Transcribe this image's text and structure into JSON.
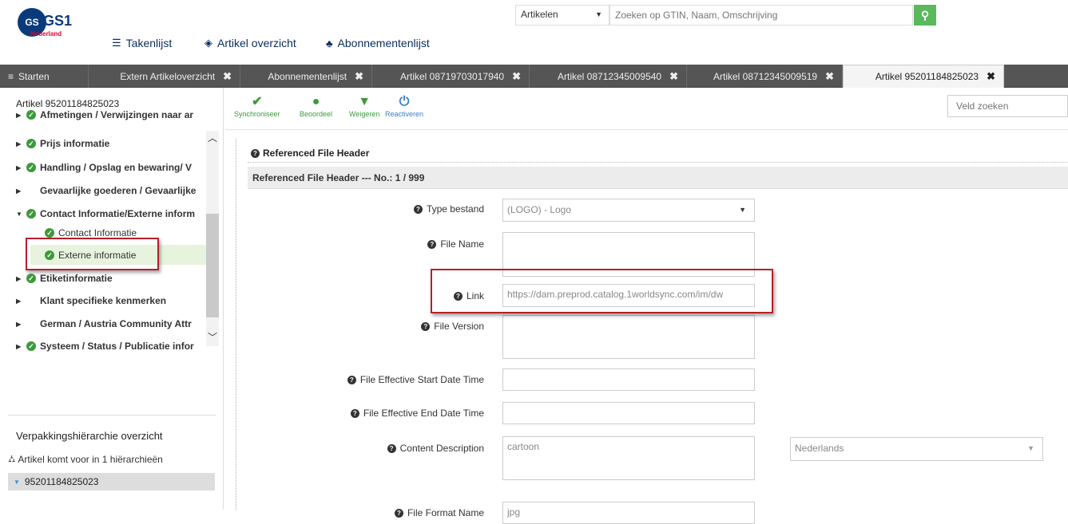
{
  "header": {
    "logo_main": "GS1",
    "logo_sub": "Nederland",
    "nav": [
      {
        "label": "Takenlijst",
        "icon": "list-icon"
      },
      {
        "label": "Artikel overzicht",
        "icon": "cube-icon"
      },
      {
        "label": "Abonnementenlijst",
        "icon": "users-icon"
      }
    ],
    "search_category": "Artikelen",
    "search_placeholder": "Zoeken op GTIN, Naam, Omschrijving"
  },
  "tabs": [
    {
      "label": "Starten"
    },
    {
      "label": "Extern Artikeloverzicht"
    },
    {
      "label": "Abonnementenlijst"
    },
    {
      "label": "Artikel 08719703017940"
    },
    {
      "label": "Artikel 08712345009540"
    },
    {
      "label": "Artikel 08712345009519"
    },
    {
      "label": "Artikel 95201184825023"
    }
  ],
  "sidebar": {
    "title": "Artikel 95201184825023",
    "items": [
      {
        "label": "Afmetingen / Verwijzingen naar ar",
        "check": true
      },
      {
        "label": "Prijs informatie",
        "check": true
      },
      {
        "label": "Handling / Opslag en bewaring/ V",
        "check": true
      },
      {
        "label": "Gevaarlijke goederen / Gevaarlijke",
        "check": false
      },
      {
        "label": "Contact Informatie/Externe inform",
        "check": true
      },
      {
        "label": "Etiketinformatie",
        "check": true
      },
      {
        "label": "Klant specifieke kenmerken",
        "check": false
      },
      {
        "label": "German / Austria Community Attr",
        "check": false
      },
      {
        "label": "Systeem / Status / Publicatie infor",
        "check": true
      }
    ],
    "subitems": [
      {
        "label": "Contact Informatie"
      },
      {
        "label": "Externe informatie"
      }
    ],
    "hierarchy_title": "Verpakkingshiërarchie overzicht",
    "hierarchy_line": "Artikel komt voor in 1 hiërarchieën",
    "hierarchy_item": "95201184825023"
  },
  "toolbar": {
    "buttons": [
      {
        "label": "Synchroniseer",
        "icon": "check-icon"
      },
      {
        "label": "Beoordeel",
        "icon": "exclamation-icon"
      },
      {
        "label": "Weigeren",
        "icon": "thumbs-down-icon"
      },
      {
        "label": "Reactiveren",
        "icon": "power-icon"
      }
    ],
    "field_search": "Veld zoeken"
  },
  "form": {
    "section_title": "Referenced File Header",
    "subheader": "Referenced File Header --- No.: 1 / 999",
    "fields": {
      "type_bestand": {
        "label": "Type bestand",
        "value": "(LOGO) - Logo"
      },
      "file_name": {
        "label": "File Name",
        "value": ""
      },
      "link": {
        "label": "Link",
        "value": "https://dam.preprod.catalog.1worldsync.com/im/dw"
      },
      "file_version": {
        "label": "File Version",
        "value": ""
      },
      "start": {
        "label": "File Effective Start Date Time",
        "value": ""
      },
      "end": {
        "label": "File Effective End Date Time",
        "value": ""
      },
      "content": {
        "label": "Content Description",
        "value": "cartoon",
        "language": "Nederlands"
      },
      "format": {
        "label": "File Format Name",
        "value": "jpg"
      }
    }
  }
}
